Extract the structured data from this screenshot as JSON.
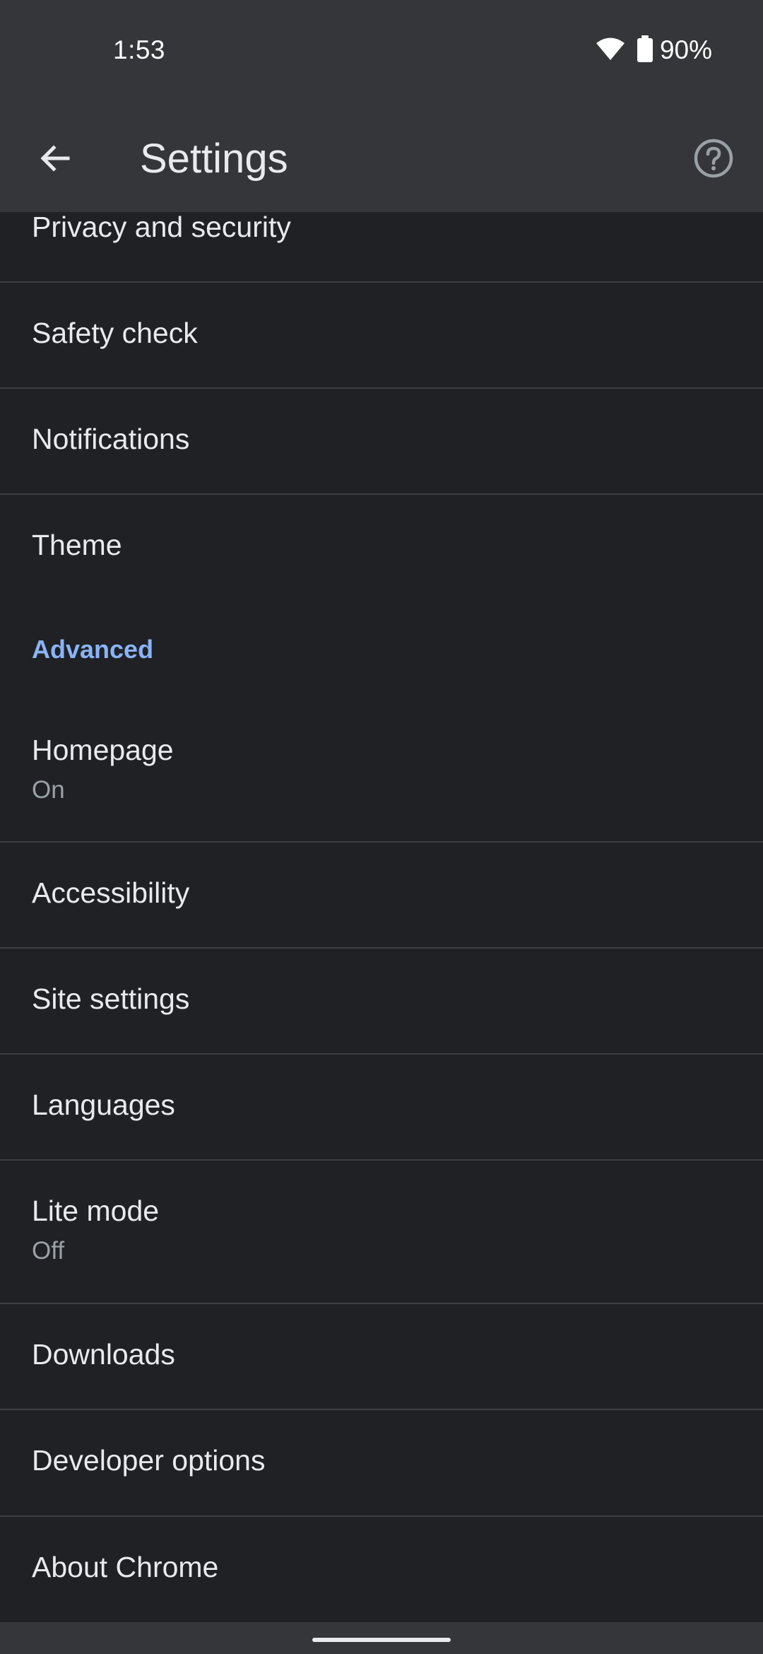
{
  "status_bar": {
    "time": "1:53",
    "battery": "90%",
    "wifi_icon": "wifi-icon",
    "battery_icon": "battery-icon"
  },
  "app_bar": {
    "title": "Settings",
    "back_icon": "arrow-back-icon",
    "help_icon": "help-circle-icon"
  },
  "list": {
    "items": [
      {
        "label": "Privacy and security"
      },
      {
        "label": "Safety check"
      },
      {
        "label": "Notifications"
      },
      {
        "label": "Theme"
      }
    ],
    "section_header": "Advanced",
    "advanced_items": [
      {
        "label": "Homepage",
        "sub": "On"
      },
      {
        "label": "Accessibility"
      },
      {
        "label": "Site settings"
      },
      {
        "label": "Languages"
      },
      {
        "label": "Lite mode",
        "sub": "Off"
      },
      {
        "label": "Downloads"
      },
      {
        "label": "Developer options"
      },
      {
        "label": "About Chrome"
      }
    ]
  },
  "colors": {
    "background": "#202124",
    "toolbar": "#35363a",
    "text_primary": "#e8eaed",
    "text_secondary": "#9aa0a6",
    "accent": "#8ab4f8",
    "divider": "#3c4043"
  }
}
